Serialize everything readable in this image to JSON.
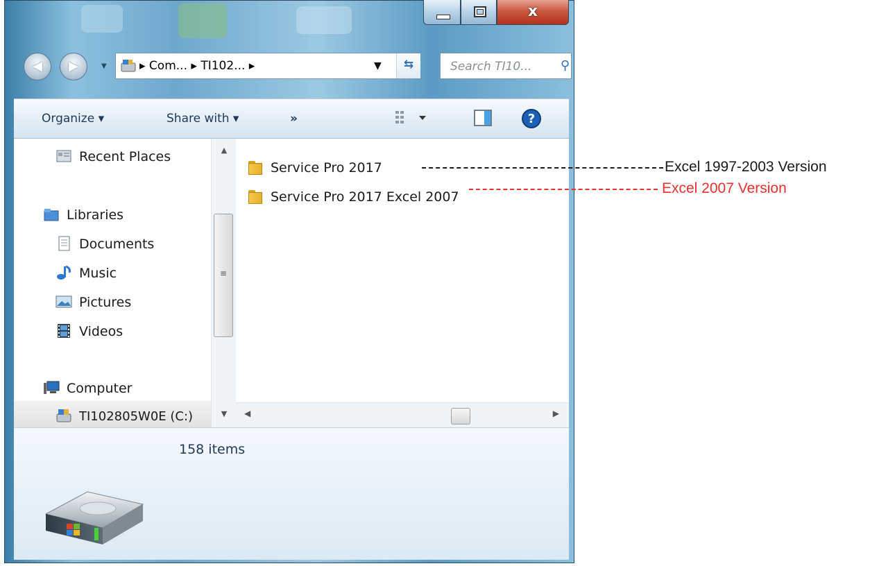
{
  "window": {
    "caption_buttons": {
      "minimize": "minimize",
      "maximize": "maximize",
      "close": "x"
    }
  },
  "nav": {
    "back_icon": "back-arrow-icon",
    "forward_icon": "forward-arrow-icon",
    "breadcrumb": "▸ Com... ▸ TI102... ▸",
    "search_placeholder": "Search TI10..."
  },
  "toolbar": {
    "organize": "Organize ▾",
    "share_with": "Share with ▾",
    "more": "»"
  },
  "navpane": {
    "items": [
      {
        "label": "Recent Places",
        "icon": "recent-places-icon"
      },
      {
        "label": "Libraries",
        "icon": "libraries-icon"
      },
      {
        "label": "Documents",
        "icon": "documents-icon"
      },
      {
        "label": "Music",
        "icon": "music-icon"
      },
      {
        "label": "Pictures",
        "icon": "pictures-icon"
      },
      {
        "label": "Videos",
        "icon": "videos-icon"
      },
      {
        "label": "Computer",
        "icon": "computer-icon"
      },
      {
        "label": "TI102805W0E (C:)",
        "icon": "drive-icon"
      }
    ]
  },
  "files": [
    {
      "name": "Service Pro 2017",
      "icon": "folder-icon"
    },
    {
      "name": "Service Pro 2017 Excel 2007",
      "icon": "folder-icon"
    }
  ],
  "details": {
    "item_count": "158 items"
  },
  "annotations": [
    {
      "text": "Excel 1997-2003 Version",
      "color": "#1a1a1a"
    },
    {
      "text": "Excel 2007 Version",
      "color": "#e8312f"
    }
  ]
}
